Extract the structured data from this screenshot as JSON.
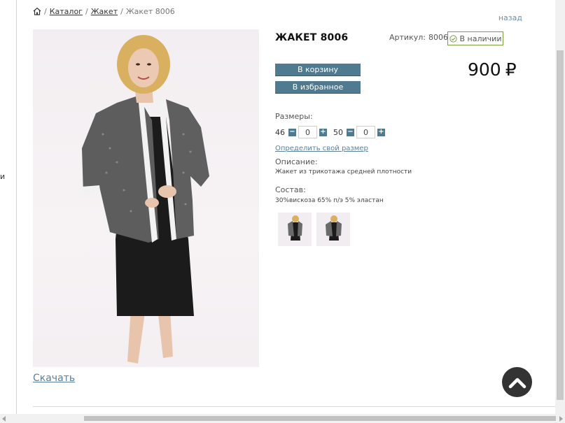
{
  "breadcrumb": {
    "home_icon": "home-icon",
    "items": [
      "Каталог",
      "Жакет"
    ],
    "current": "Жакет 8006"
  },
  "nav": {
    "back": "назад"
  },
  "edge_text": "и",
  "product": {
    "title": "ЖАКЕТ 8006",
    "sku_label": "Артикул:",
    "sku_value": "8006",
    "stock": "В наличии",
    "price": "900",
    "currency": "₽",
    "buttons": {
      "cart": "В корзину",
      "favorites": "В избранное"
    },
    "sizes_label": "Размеры:",
    "sizes": [
      {
        "size": "46",
        "qty": "0"
      },
      {
        "size": "50",
        "qty": "0"
      }
    ],
    "size_guide": "Определить свой размер",
    "description_label": "Описание:",
    "description": "Жакет из трикотажа средней плотности",
    "composition_label": "Состав:",
    "composition": "30%вискоза 65% п/э 5% эластан"
  },
  "download": "Скачать",
  "colors": {
    "accent": "#4f7a8f",
    "link": "#5a7f9a",
    "stock_border": "#7d9f3a",
    "scroll_top_bg": "#333333"
  }
}
